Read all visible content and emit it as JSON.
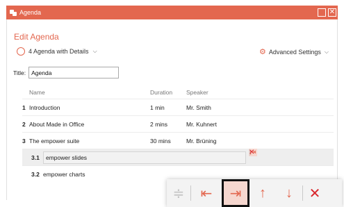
{
  "window": {
    "title": "Agenda"
  },
  "header": {
    "heading": "Edit Agenda",
    "preset": {
      "label": "4 Agenda with Details"
    },
    "advanced": {
      "label": "Advanced Settings"
    }
  },
  "form": {
    "title_label": "Title:",
    "title_value": "Agenda"
  },
  "table": {
    "columns": {
      "name": "Name",
      "duration": "Duration",
      "speaker": "Speaker"
    },
    "rows": [
      {
        "num": "1",
        "name": "Introduction",
        "duration": "1 min",
        "speaker": "Mr. Smith"
      },
      {
        "num": "2",
        "name": "About Made in Office",
        "duration": "2 mins",
        "speaker": "Mr. Kuhnert"
      },
      {
        "num": "3",
        "name": "The empower suite",
        "duration": "30 mins",
        "speaker": "Mr. Brüning"
      },
      {
        "num": "3.1",
        "name": "empower slides",
        "duration": "",
        "speaker": ""
      },
      {
        "num": "3.2",
        "name": "empower charts",
        "duration": "",
        "speaker": ""
      }
    ]
  },
  "icons": [
    "app-icon",
    "preset-icon",
    "gear-icon",
    "chevron-down-icon",
    "maximize-icon",
    "close-icon",
    "drag-handle-icon",
    "outdent-icon",
    "indent-icon",
    "move-up-icon",
    "move-down-icon",
    "delete-icon"
  ],
  "colors": {
    "accent": "#e3674f",
    "delete": "#d9262c",
    "selected_bg": "#f6d7cf"
  }
}
